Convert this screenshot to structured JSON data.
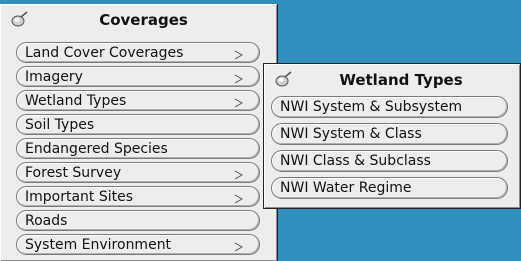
{
  "coverages_menu": {
    "title": "Coverages",
    "items": [
      {
        "label": "Land Cover Coverages",
        "submenu": true
      },
      {
        "label": "Imagery",
        "submenu": true
      },
      {
        "label": "Wetland Types",
        "submenu": true
      },
      {
        "label": "Soil Types",
        "submenu": false
      },
      {
        "label": "Endangered Species",
        "submenu": false
      },
      {
        "label": "Forest Survey",
        "submenu": true
      },
      {
        "label": "Important Sites",
        "submenu": true
      },
      {
        "label": "Roads",
        "submenu": false
      },
      {
        "label": "System Environment",
        "submenu": true
      }
    ]
  },
  "wetland_menu": {
    "title": "Wetland Types",
    "items": [
      {
        "label": "NWI System & Subsystem"
      },
      {
        "label": "NWI System & Class"
      },
      {
        "label": "NWI Class & Subclass"
      },
      {
        "label": "NWI Water Regime"
      }
    ]
  },
  "icons": {
    "pin": "pushpin-icon",
    "submenu": "submenu-arrow-icon"
  },
  "colors": {
    "desktop": "#2f8fbf",
    "menu_bg": "#ededed"
  }
}
